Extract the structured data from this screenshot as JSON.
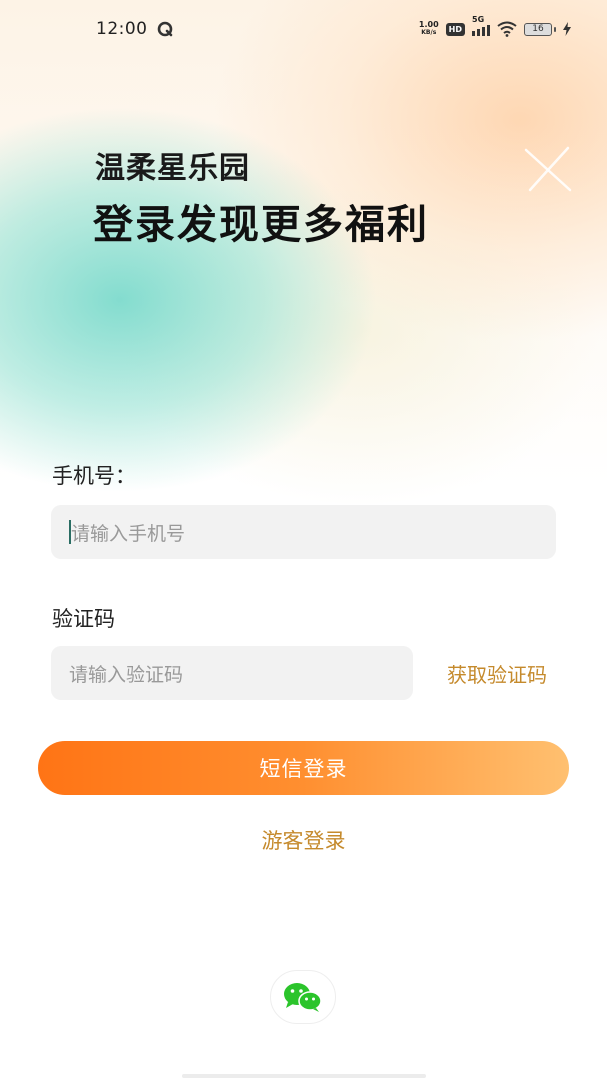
{
  "status_bar": {
    "time": "12:00",
    "net_speed_value": "1.00",
    "net_speed_unit": "KB/s",
    "hd": "HD",
    "network": "5G",
    "battery": "16"
  },
  "hero": {
    "app_name": "温柔星乐园",
    "slogan": "登录发现更多福利"
  },
  "form": {
    "phone_label": "手机号：",
    "phone_placeholder": "请输入手机号",
    "code_label": "验证码",
    "code_placeholder": "请输入验证码",
    "get_code": "获取验证码",
    "sms_login": "短信登录",
    "guest_login": "游客登录"
  },
  "colors": {
    "accent": "#c58a2c",
    "button_start": "#ff7415",
    "button_end": "#ffc070",
    "wechat_green": "#2bc42b"
  },
  "icons": {
    "wechat": "wechat-icon"
  }
}
